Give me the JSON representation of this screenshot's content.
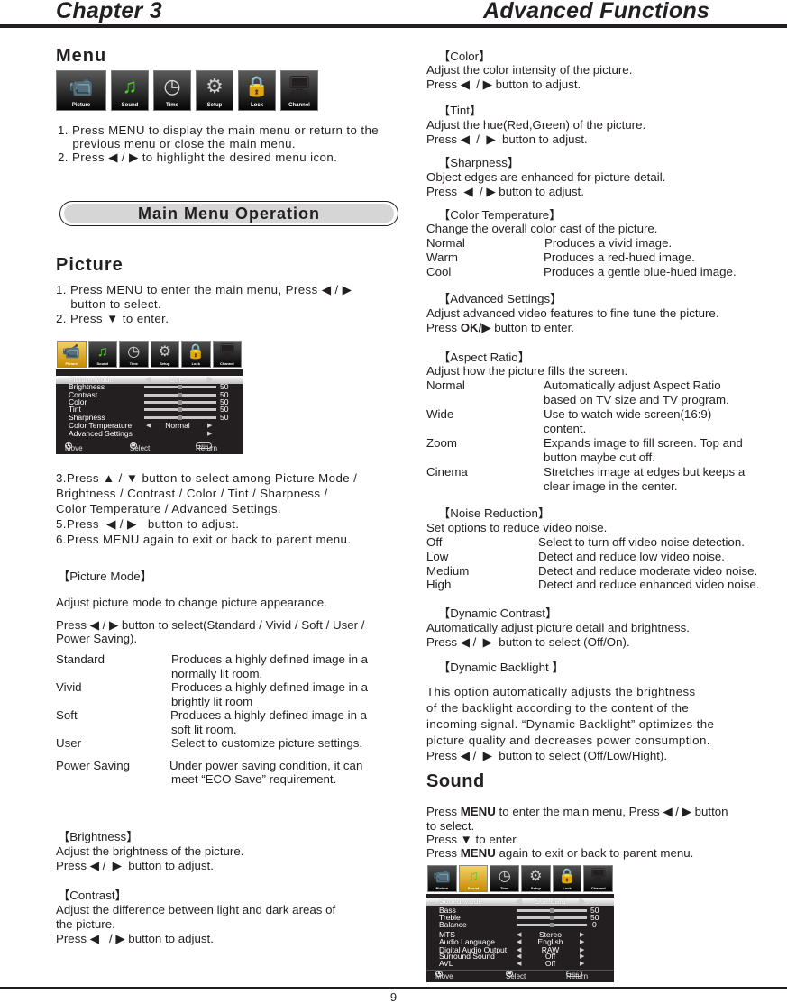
{
  "header": {
    "chapter": "Chapter 3",
    "title": "Advanced Functions"
  },
  "page_number": "9",
  "menu_section": {
    "heading": "Menu",
    "icons": [
      {
        "name": "picture",
        "label": "Picture",
        "glyph": "📹"
      },
      {
        "name": "sound",
        "label": "Sound",
        "glyph": "♫"
      },
      {
        "name": "time",
        "label": "Time",
        "glyph": "◷"
      },
      {
        "name": "setup",
        "label": "Setup",
        "glyph": "⚙"
      },
      {
        "name": "lock",
        "label": "Lock",
        "glyph": "🔒"
      },
      {
        "name": "channel",
        "label": "Channel",
        "glyph": "🖥"
      }
    ],
    "steps": [
      "1. Press MENU to display the main menu or return to the",
      "    previous menu or close the main menu.",
      "2. Press  ◀ / ▶ to highlight the desired menu icon."
    ]
  },
  "main_menu_operation": "Main Menu Operation",
  "picture_section": {
    "heading": "Picture",
    "steps_top": [
      "1. Press MENU to enter the main menu, Press ◀ / ▶",
      "    button to select.",
      "2. Press ▼ to enter."
    ],
    "steps_bottom": [
      "3.Press  ▲ / ▼  button to select among Picture Mode /",
      "Brightness / Contrast / Color / Tint / Sharpness /",
      "Color Temperature / Advanced Settings.",
      "5.Press  ◀ / ▶   button to adjust.",
      "6.Press MENU again to exit or back to parent menu."
    ],
    "osd": {
      "tabs": [
        "Picture",
        "Sound",
        "Time",
        "Setup",
        "Lock",
        "Channel"
      ],
      "active_tab": "Picture",
      "highlight": {
        "label": "Picture Mode",
        "value": "User"
      },
      "sliders": [
        {
          "label": "Brightness",
          "value": 50
        },
        {
          "label": "Contrast",
          "value": 50
        },
        {
          "label": "Color",
          "value": 50
        },
        {
          "label": "Tint",
          "value": 50
        },
        {
          "label": "Sharpness",
          "value": 50
        }
      ],
      "options": [
        {
          "label": "Color Temperature",
          "value": "Normal"
        },
        {
          "label": "Advanced Settings",
          "value": ""
        }
      ],
      "footer": {
        "move": "Move",
        "select": "Select",
        "menu": "MENU",
        "return": "Return"
      }
    }
  },
  "picture_mode": {
    "heading": "【Picture Mode】",
    "intro": "Adjust picture mode to change picture appearance.",
    "press": [
      "Press ◀ / ▶ button to select(Standard / Vivid / Soft / User /",
      "Power Saving)."
    ],
    "modes": [
      {
        "name": "Standard",
        "desc": [
          "Produces a highly defined image in a",
          "normally lit room."
        ]
      },
      {
        "name": "Vivid",
        "desc": [
          "Produces a highly defined image in a",
          "brightly lit room"
        ]
      },
      {
        "name": "Soft",
        "desc": [
          "Produces a highly defined image in a",
          "soft lit room."
        ]
      },
      {
        "name": "User",
        "desc": [
          "Select to customize picture settings."
        ]
      },
      {
        "name": "Power Saving",
        "desc": [
          "Under power saving condition, it can",
          "meet “ECO Save” requirement."
        ]
      }
    ]
  },
  "brightness": {
    "heading": "【Brightness】",
    "lines": [
      "Adjust the brightness of  the picture.",
      "Press ◀ /  ▶  button to adjust."
    ]
  },
  "contrast": {
    "heading": "【Contrast】",
    "lines": [
      "Adjust the difference between light and dark areas of",
      "the picture.",
      "Press ◀   / ▶ button to adjust."
    ]
  },
  "color": {
    "heading": "【Color】",
    "lines": [
      "Adjust the color intensity of the picture.",
      "Press ◀  / ▶ button to adjust."
    ]
  },
  "tint": {
    "heading": "【Tint】",
    "lines": [
      "Adjust the hue(Red,Green) of the picture.",
      "Press ◀  /  ▶  button to adjust."
    ]
  },
  "sharpness": {
    "heading": "【Sharpness】",
    "lines": [
      "Object edges are enhanced for picture detail.",
      "Press  ◀  / ▶ button to adjust."
    ]
  },
  "color_temperature": {
    "heading": "【Color Temperature】",
    "intro": "Change the overall color cast of the picture.",
    "items": [
      {
        "name": "Normal",
        "desc": "Produces a vivid image."
      },
      {
        "name": "Warm",
        "desc": "Produces a red-hued image."
      },
      {
        "name": "Cool",
        "desc": "Produces a gentle blue-hued image."
      }
    ]
  },
  "advanced_settings": {
    "heading": "【Advanced Settings】",
    "intro": "Adjust advanced video features to fine tune the picture.",
    "press_pre": "Press ",
    "press_bold": "OK/",
    "press_post": "▶ button to enter."
  },
  "aspect_ratio": {
    "heading": "【Aspect Ratio】",
    "intro": "Adjust how the picture fills the screen.",
    "items": [
      {
        "name": "Normal",
        "desc": [
          "Automatically  adjust Aspect Ratio",
          "based on TV size and TV program."
        ]
      },
      {
        "name": "Wide",
        "desc": [
          "Use to watch wide screen(16:9)",
          "content."
        ]
      },
      {
        "name": "Zoom",
        "desc": [
          "Expands image to fill screen. Top and",
          "button maybe cut off."
        ]
      },
      {
        "name": "Cinema",
        "desc": [
          "Stretches image at edges but keeps  a",
          "clear image in the center."
        ]
      }
    ]
  },
  "noise_reduction": {
    "heading": "【Noise Reduction】",
    "intro": "Set options to reduce video noise.",
    "items": [
      {
        "name": "Off",
        "desc": "Select to turn off video noise detection."
      },
      {
        "name": "Low",
        "desc": "Detect and reduce low video noise."
      },
      {
        "name": "Medium",
        "desc": "Detect and reduce moderate video noise."
      },
      {
        "name": "High",
        "desc": "Detect and reduce enhanced video noise."
      }
    ]
  },
  "dynamic_contrast": {
    "heading": "【Dynamic Contrast】",
    "lines": [
      "Automatically adjust picture detail and brightness.",
      "Press ◀ /  ▶  button to select (Off/On)."
    ]
  },
  "dynamic_backlight": {
    "heading": "【Dynamic Backlight 】",
    "lines": [
      "This option automatically adjusts the brightness",
      "of the backlight according to the content of the",
      "incoming signal. “Dynamic Backlight” optimizes the",
      "picture quality and decreases power consumption.",
      "Press ◀ /  ▶  button to select (Off/Low/Hight)."
    ]
  },
  "sound_section": {
    "heading": "Sound",
    "line1_pre": "Press ",
    "line1_bold": "MENU",
    "line1_post": " to enter the main menu, Press ◀ / ▶ button",
    "line2": "to select.",
    "line3": "Press ▼ to enter.",
    "line4_pre": "Press ",
    "line4_bold": "MENU",
    "line4_post": " again to exit or back to parent menu.",
    "osd": {
      "tabs": [
        "Picture",
        "Sound",
        "Time",
        "Setup",
        "Lock",
        "Channel"
      ],
      "active_tab": "Sound",
      "highlight": {
        "label": "Sound Mode",
        "value": "Standard"
      },
      "sliders": [
        {
          "label": "Bass",
          "value": 50
        },
        {
          "label": "Treble",
          "value": 50
        },
        {
          "label": "Balance",
          "value": 0
        }
      ],
      "options": [
        {
          "label": "MTS",
          "value": "Stereo"
        },
        {
          "label": "Audio Language",
          "value": "English"
        },
        {
          "label": "Digital Audio Output",
          "value": "RAW"
        },
        {
          "label": "Surround Sound",
          "value": "Off"
        },
        {
          "label": "AVL",
          "value": "Off"
        }
      ],
      "footer": {
        "move": "Move",
        "select": "Select",
        "menu": "MENU",
        "return": "Return"
      }
    }
  }
}
